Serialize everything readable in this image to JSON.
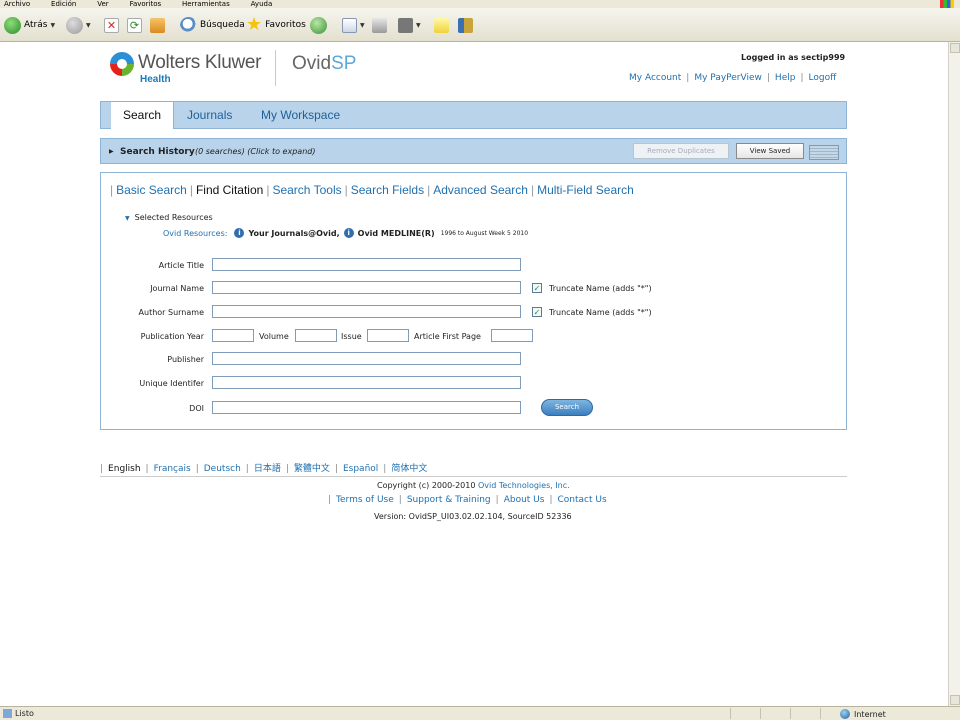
{
  "browser": {
    "menu": [
      "Archivo",
      "Edición",
      "Ver",
      "Favoritos",
      "Herramientas",
      "Ayuda"
    ],
    "toolbar": {
      "back_label": "Atrás",
      "search_label": "Búsqueda",
      "favorites_label": "Favoritos"
    },
    "status": {
      "left": "Listo",
      "right": "Internet"
    }
  },
  "header": {
    "brand": "Wolters Kluwer",
    "brand_sub": "Health",
    "product_main": "Ovid",
    "product_accent": "SP",
    "logged_in": "Logged in as sectip999",
    "links": [
      "My Account",
      "My PayPerView",
      "Help",
      "Logoff"
    ]
  },
  "tabs": [
    "Search",
    "Journals",
    "My Workspace"
  ],
  "history": {
    "title": "Search History",
    "subtitle": "(0 searches) (Click to expand)",
    "remove_duplicates": "Remove Duplicates",
    "view_saved": "View Saved"
  },
  "subtabs": [
    "Basic Search",
    "Find Citation",
    "Search Tools",
    "Search Fields",
    "Advanced Search",
    "Multi-Field Search"
  ],
  "resources": {
    "heading": "Selected Resources",
    "label": "Ovid Resources:",
    "items": [
      "Your Journals@Ovid,",
      "Ovid MEDLINE(R)"
    ],
    "medline_range": "1996 to August Week 5 2010"
  },
  "form": {
    "article_title": "Article Title",
    "journal_name": "Journal Name",
    "author_surname": "Author Surname",
    "publication_year": "Publication Year",
    "volume": "Volume",
    "issue": "Issue",
    "article_first_page": "Article First Page",
    "publisher": "Publisher",
    "unique_identifier": "Unique Identifer",
    "doi": "DOI",
    "truncate_label": "Truncate Name (adds \"*\")",
    "search_button": "Search"
  },
  "footer": {
    "languages": [
      "English",
      "Français",
      "Deutsch",
      "日本語",
      "繁體中文",
      "Español",
      "简体中文"
    ],
    "copyright_prefix": "Copyright (c) 2000-2010",
    "copyright_link": "Ovid Technologies, Inc.",
    "links": [
      "Terms of Use",
      "Support & Training",
      "About Us",
      "Contact Us"
    ],
    "version": "Version: OvidSP_UI03.02.02.104, SourceID 52336"
  }
}
